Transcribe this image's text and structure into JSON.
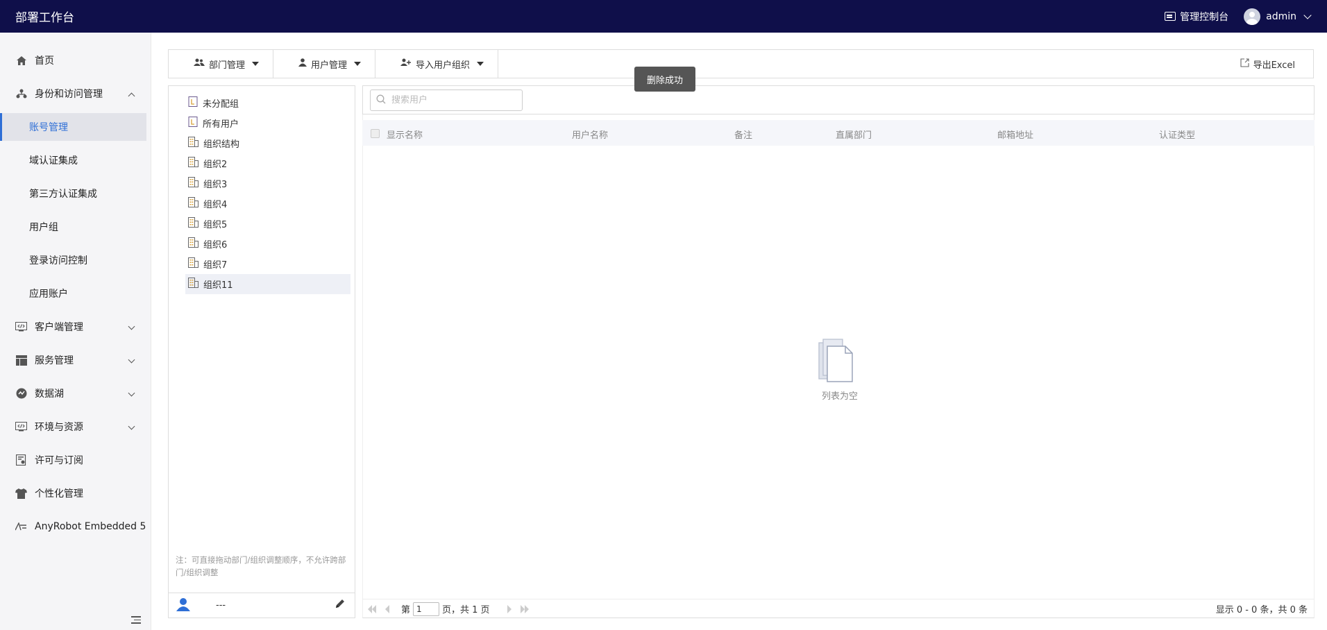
{
  "header": {
    "app_title": "部署工作台",
    "console_label": "管理控制台",
    "user_name": "admin"
  },
  "sidebar": {
    "items": [
      {
        "label": "首页",
        "icon": "home-icon"
      },
      {
        "label": "身份和访问管理",
        "icon": "org-icon",
        "expanded": true
      },
      {
        "label": "客户端管理",
        "icon": "code-window-icon"
      },
      {
        "label": "服务管理",
        "icon": "layout-icon"
      },
      {
        "label": "数据湖",
        "icon": "data-lake-icon"
      },
      {
        "label": "环境与资源",
        "icon": "code-window-icon"
      },
      {
        "label": "许可与订阅",
        "icon": "license-icon"
      },
      {
        "label": "个性化管理",
        "icon": "tshirt-icon"
      },
      {
        "label": "AnyRobot Embedded 5",
        "icon": "anyrobot-icon"
      }
    ],
    "sub_items": [
      "账号管理",
      "域认证集成",
      "第三方认证集成",
      "用户组",
      "登录访问控制",
      "应用账户"
    ],
    "active_sub": "账号管理"
  },
  "toolbar": {
    "dept_label": "部门管理",
    "user_label": "用户管理",
    "import_label": "导入用户组织",
    "export_label": "导出Excel"
  },
  "toast": "删除成功",
  "tree": {
    "nodes": [
      "未分配组",
      "所有用户",
      "组织结构",
      "组织2",
      "组织3",
      "组织4",
      "组织5",
      "组织6",
      "组织7",
      "组织11"
    ],
    "selected": "组织11",
    "note": "注：可直接拖动部门/组织调整顺序，不允许跨部门/组织调整",
    "footer_value": "---"
  },
  "search": {
    "placeholder": "搜索用户",
    "value": ""
  },
  "table": {
    "columns": [
      "显示名称",
      "用户名称",
      "备注",
      "直属部门",
      "邮箱地址",
      "认证类型"
    ],
    "rows": [],
    "empty_text": "列表为空"
  },
  "pagination": {
    "prefix": "第",
    "current_page": "1",
    "suffix": "页，共 1 页",
    "summary": "显示 0 - 0 条，共 0 条"
  },
  "colors": {
    "topbar": "#0f0f4a",
    "accent": "#2f6fd6",
    "sidebar_bg": "#f5f5f7"
  }
}
